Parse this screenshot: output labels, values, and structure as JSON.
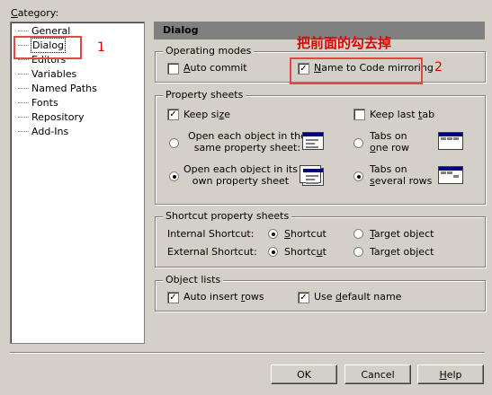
{
  "category": {
    "label": "Category:",
    "accel": "C",
    "rest": "ategory:"
  },
  "tree": [
    {
      "label": "General"
    },
    {
      "label": "Dialog",
      "selected": true
    },
    {
      "label": "Editors"
    },
    {
      "label": "Variables"
    },
    {
      "label": "Named Paths"
    },
    {
      "label": "Fonts"
    },
    {
      "label": "Repository"
    },
    {
      "label": "Add-Ins"
    }
  ],
  "annotations": {
    "num1": "1",
    "num2": "2",
    "chinese": "把前面的勾去掉",
    "accent": "#e04848"
  },
  "panel": {
    "title": "Dialog"
  },
  "operating_modes": {
    "title": "Operating modes",
    "auto_commit": {
      "accel": "A",
      "rest": "uto commit",
      "checked": false
    },
    "name_mirroring": {
      "accel": "N",
      "rest": "ame to Code mirroring",
      "checked": true
    }
  },
  "property_sheets": {
    "title": "Property sheets",
    "keep_size": {
      "pre": "Keep si",
      "accel": "z",
      "post": "e",
      "checked": true
    },
    "keep_last_tab": {
      "pre": "Keep last ",
      "accel": "t",
      "post": "ab",
      "checked": false
    },
    "same_sheet": {
      "line1": "Open each object in the",
      "line2": "same property sheet:",
      "checked": false
    },
    "own_sheet": {
      "line1": "Open each object in its",
      "line2": "own property sheet",
      "checked": true
    },
    "one_row": {
      "line1": "Tabs on",
      "line2_accel": "o",
      "line2_rest": "ne row",
      "checked": false
    },
    "several_rows": {
      "line1": "Tabs on",
      "line2_accel": "s",
      "line2_rest": "everal rows",
      "checked": true
    }
  },
  "shortcut_sheets": {
    "title": "Shortcut property sheets",
    "internal_label": "Internal Shortcut:",
    "external_label": "External Shortcut:",
    "int_shortcut": {
      "accel": "S",
      "rest": "hortcut",
      "checked": true
    },
    "int_target": {
      "accel": "T",
      "rest": "arget object",
      "checked": false
    },
    "ext_shortcut": {
      "pre": "Shortc",
      "accel": "u",
      "post": "t",
      "checked": true
    },
    "ext_target": {
      "pre": "Tar",
      "accel": "g",
      "post": "et object",
      "checked": false
    }
  },
  "object_lists": {
    "title": "Object lists",
    "auto_insert": {
      "pre": "Auto insert ",
      "accel": "r",
      "post": "ows",
      "checked": true
    },
    "use_default": {
      "pre": "Use ",
      "accel": "d",
      "post": "efault name",
      "checked": true
    }
  },
  "buttons": {
    "ok": "OK",
    "cancel": "Cancel",
    "help_accel": "H",
    "help_rest": "elp"
  }
}
